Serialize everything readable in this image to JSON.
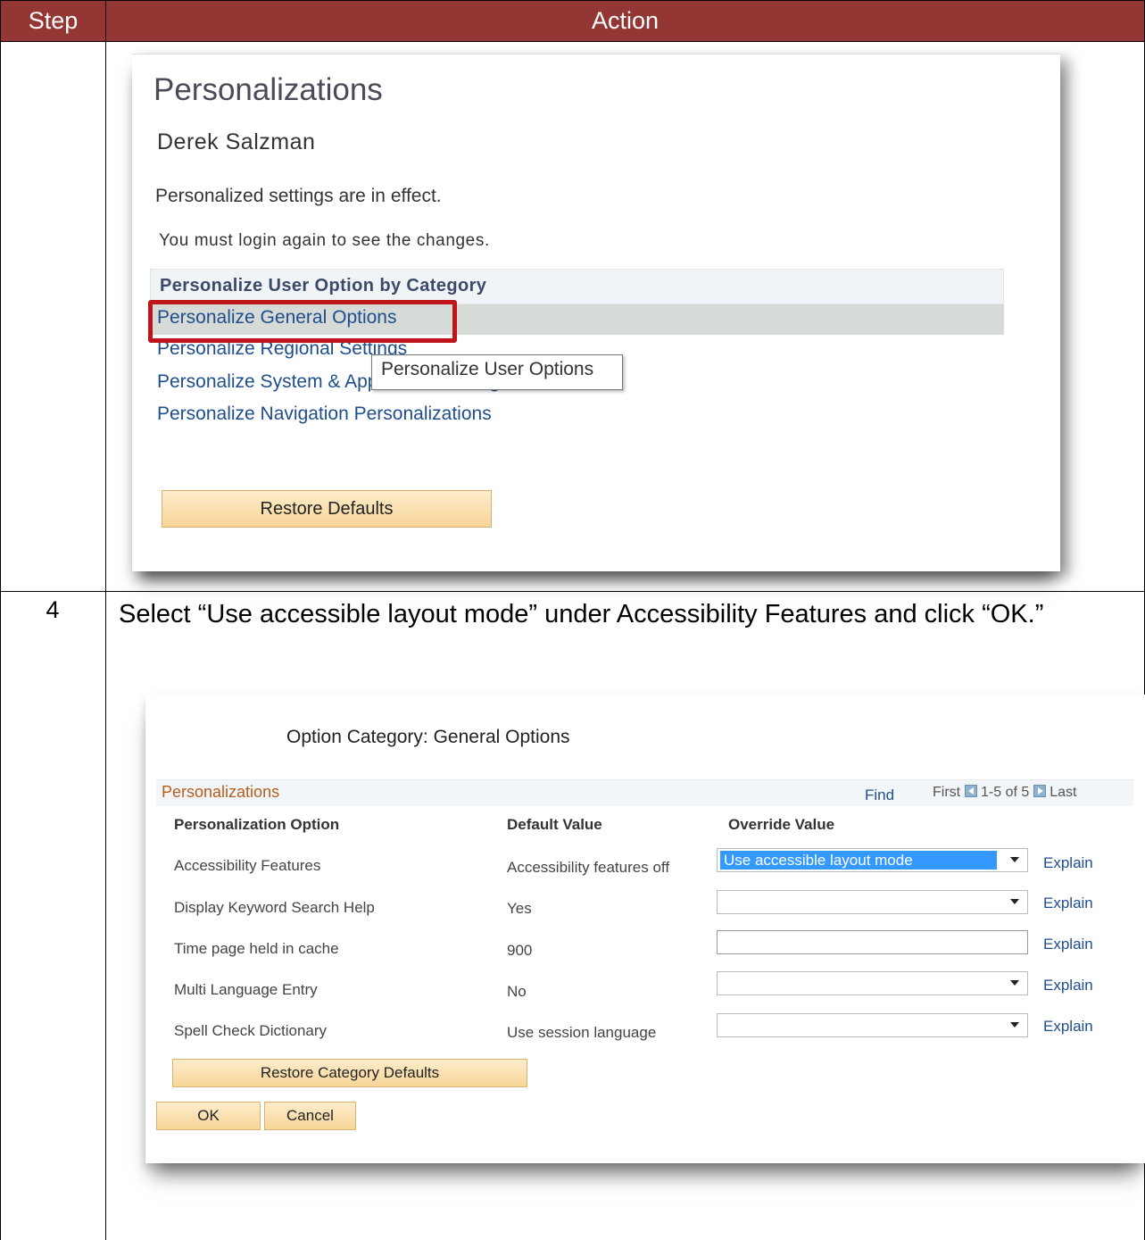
{
  "header": {
    "step_label": "Step",
    "action_label": "Action"
  },
  "row4": {
    "step_number": "4",
    "instruction": "Select “Use accessible layout mode” under Accessibility Features and click “OK.”"
  },
  "personalizations_page": {
    "title": "Personalizations",
    "user_name": "Derek Salzman",
    "status_message": "Personalized settings are in effect.",
    "login_message": "You must login again to see the changes.",
    "category_header": "Personalize User Option by Category",
    "links": [
      "Personalize General Options",
      "Personalize Regional Settings",
      "Personalize System & Application Settings",
      "Personalize Navigation Personalizations"
    ],
    "tooltip": "Personalize User Options",
    "restore_button": "Restore Defaults"
  },
  "general_options_page": {
    "title": "Option Category:  General Options",
    "grid_title": "Personalizations",
    "find_link": "Find",
    "nav": {
      "first": "First",
      "range": "1-5 of 5",
      "last": "Last"
    },
    "columns": [
      "Personalization Option",
      "Default Value",
      "Override Value"
    ],
    "rows": [
      {
        "option": "Accessibility Features",
        "default": "Accessibility features off",
        "override": "Use accessible layout mode",
        "explain": "Explain"
      },
      {
        "option": "Display Keyword Search Help",
        "default": "Yes",
        "override": "",
        "explain": "Explain"
      },
      {
        "option": "Time page held in cache",
        "default": "900",
        "override": "",
        "explain": "Explain"
      },
      {
        "option": "Multi Language Entry",
        "default": "No",
        "override": "",
        "explain": "Explain"
      },
      {
        "option": "Spell Check Dictionary",
        "default": "Use session language",
        "override": "",
        "explain": "Explain"
      }
    ],
    "restore_button": "Restore Category Defaults",
    "ok_button": "OK",
    "cancel_button": "Cancel"
  },
  "colors": {
    "header_bg": "#943634",
    "link": "#1f4e8c",
    "highlight_box": "#c0141b",
    "grid_title": "#b75d1c"
  }
}
